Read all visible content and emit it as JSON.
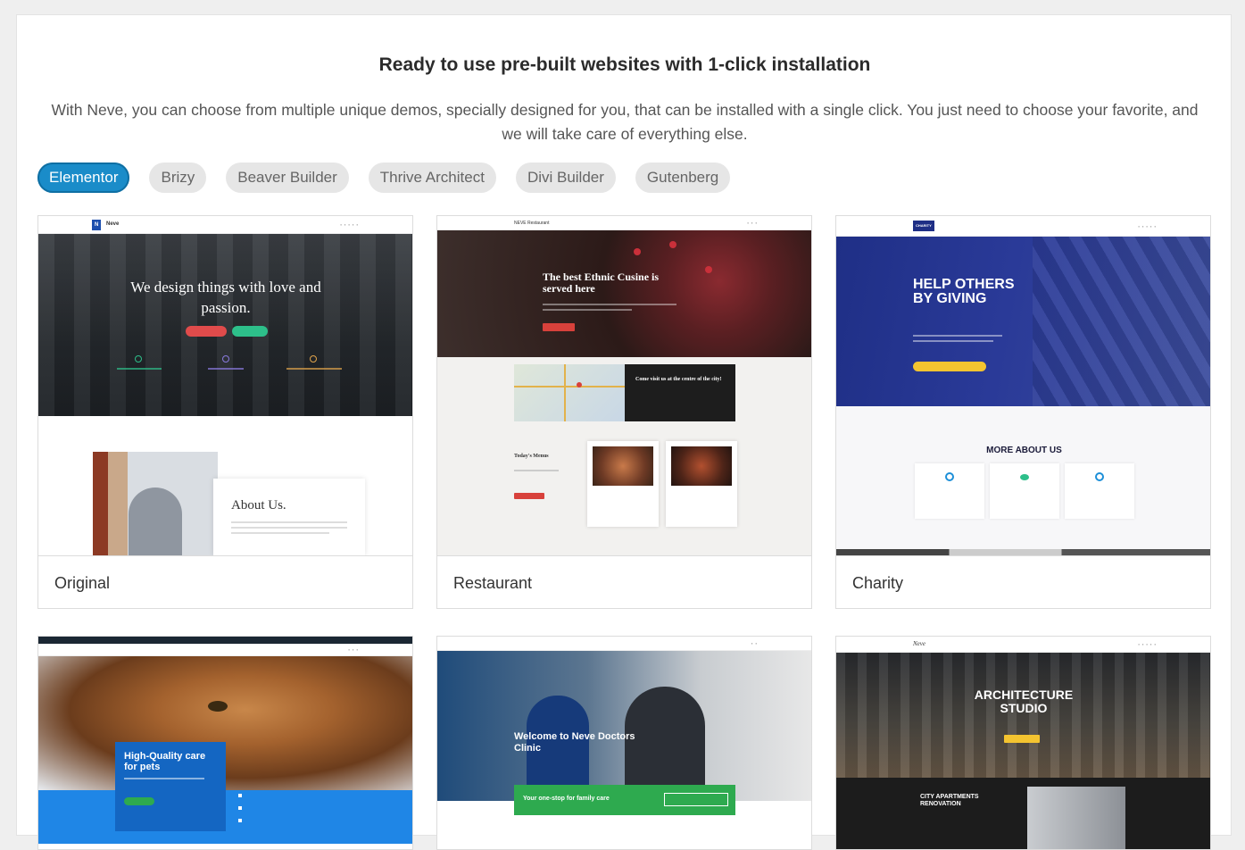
{
  "header": {
    "title": "Ready to use pre-built websites with 1-click installation",
    "subtitle": "With Neve, you can choose from multiple unique demos, specially designed for you, that can be installed with a single click. You just need to choose your favorite, and we will take care of everything else."
  },
  "filters": [
    {
      "label": "Elementor",
      "active": true
    },
    {
      "label": "Brizy",
      "active": false
    },
    {
      "label": "Beaver Builder",
      "active": false
    },
    {
      "label": "Thrive Architect",
      "active": false
    },
    {
      "label": "Divi Builder",
      "active": false
    },
    {
      "label": "Gutenberg",
      "active": false
    }
  ],
  "cards": [
    {
      "label": "Original",
      "preview": {
        "brand": "Neve",
        "logo": "N",
        "hero": "We design things with love and passion.",
        "about": "About Us."
      }
    },
    {
      "label": "Restaurant",
      "preview": {
        "brand": "NEVE Restaurant",
        "hero": "The best Ethnic Cusine is served here",
        "visit": "Come visit us at the centre of the city!",
        "menus": "Today's Menus"
      }
    },
    {
      "label": "Charity",
      "preview": {
        "logo": "CHARITY",
        "hero": "HELP OTHERS BY GIVING",
        "more": "MORE ABOUT US"
      }
    },
    {
      "label": "",
      "preview": {
        "hero": "High-Quality care for pets"
      }
    },
    {
      "label": "",
      "preview": {
        "hero": "Welcome to Neve Doctors Clinic",
        "banner": "Your one-stop for family care"
      }
    },
    {
      "label": "",
      "preview": {
        "brand": "Neve",
        "hero": "ARCHITECTURE STUDIO",
        "sub": "CITY APARTMENTS RENOVATION"
      }
    }
  ],
  "colors": {
    "accent": "#1a8cc9",
    "pill_bg": "#e6e6e6",
    "charity_blue": "#1f2f86",
    "restaurant_red": "#d8413b",
    "clinic_green": "#2eaa4f",
    "pets_blue": "#1f86e6"
  }
}
